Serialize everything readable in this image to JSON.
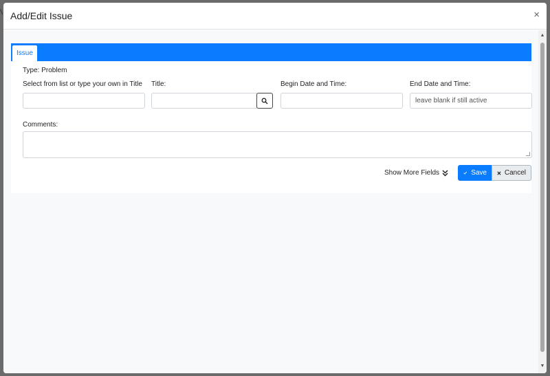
{
  "modal": {
    "title": "Add/Edit Issue",
    "close_label": "×"
  },
  "tabs": [
    {
      "label": "Issue"
    }
  ],
  "form": {
    "type_text": "Type: Problem",
    "select_label": "Select from list or type your own in Title",
    "select_value": "",
    "title_label": "Title:",
    "title_value": "",
    "begin_label": "Begin Date and Time:",
    "begin_value": "",
    "end_label": "End Date and Time:",
    "end_placeholder": "leave blank if still active",
    "comments_label": "Comments:",
    "comments_value": ""
  },
  "actions": {
    "more_fields_label": "Show More Fields",
    "save_label": "Save",
    "cancel_label": "Cancel"
  },
  "colors": {
    "accent": "#0a7cff"
  }
}
